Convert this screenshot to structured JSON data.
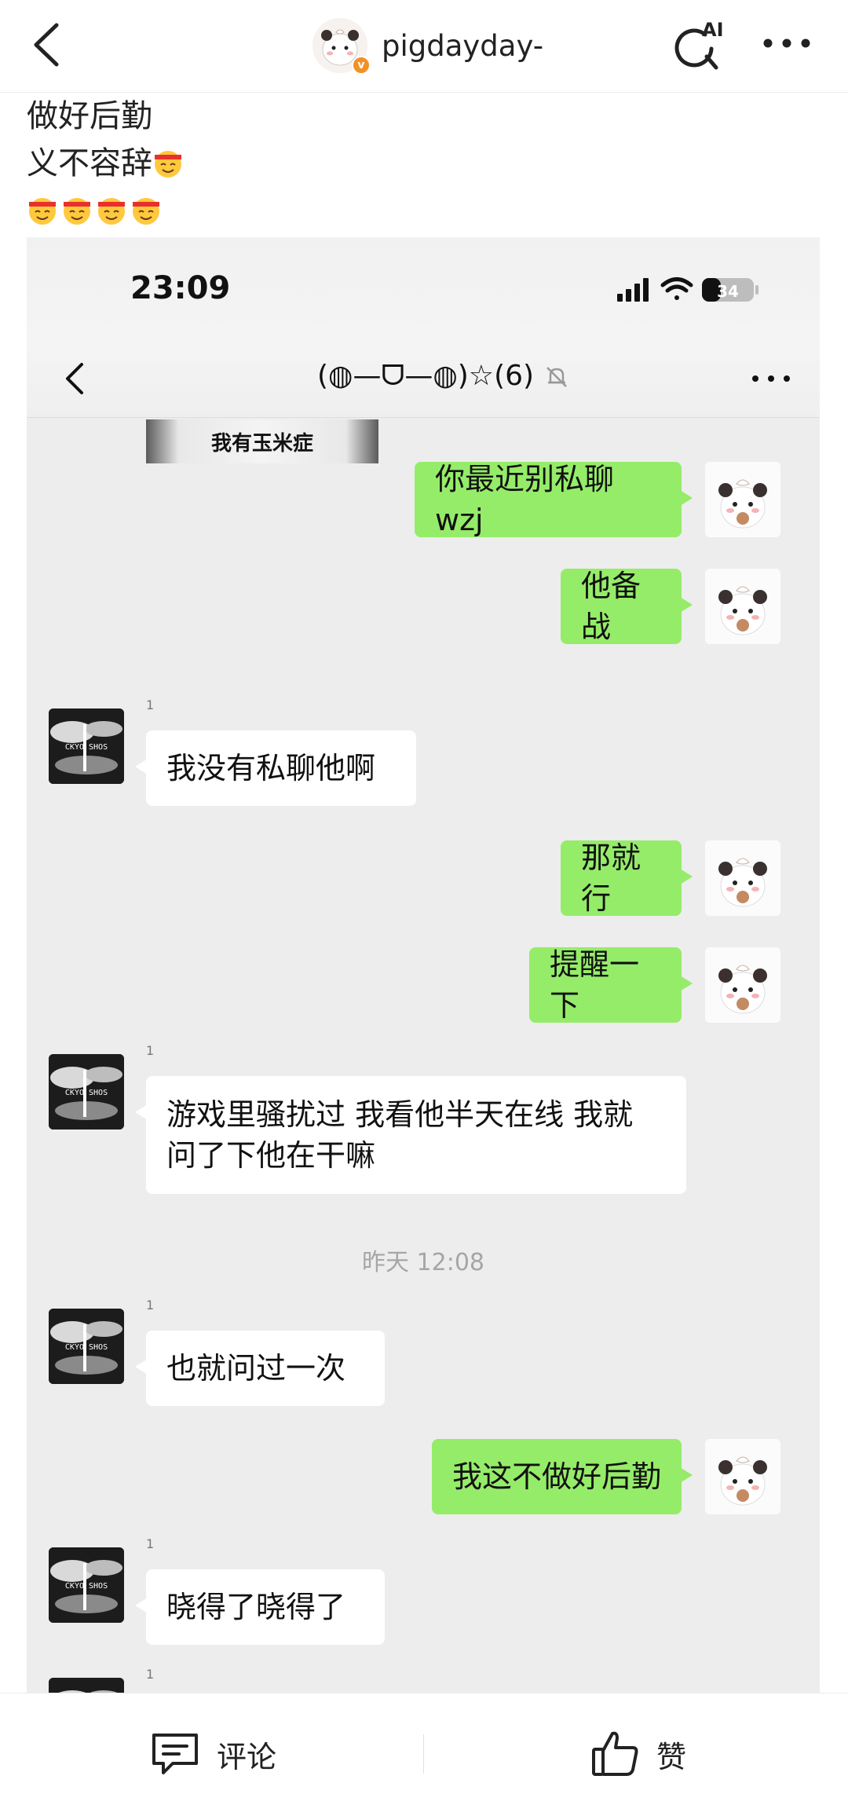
{
  "header": {
    "username": "pigdayday-",
    "ai_label": "AI"
  },
  "post": {
    "line1": "做好后勤",
    "line2": "义不容辞"
  },
  "screenshot": {
    "status_time": "23:09",
    "battery": "34",
    "chat_title": "(◍—ᗜ—◍)☆(6)",
    "sticker_caption": "我有玉米症",
    "messages": [
      {
        "from": "me",
        "text": "你最近别私聊 wzj"
      },
      {
        "from": "me",
        "text": "他备战"
      },
      {
        "from": "other",
        "sender_label": "1",
        "text": "我没有私聊他啊"
      },
      {
        "from": "me",
        "text": "那就行"
      },
      {
        "from": "me",
        "text": "提醒一下"
      },
      {
        "from": "other",
        "sender_label": "1",
        "text": "游戏里骚扰过 我看他半天在线 我就\n问了下他在干嘛"
      },
      {
        "from": "other",
        "sender_label": "1",
        "text": "也就问过一次"
      },
      {
        "from": "me",
        "text": "我这不做好后勤"
      },
      {
        "from": "other",
        "sender_label": "1",
        "text": "晓得了晓得了"
      },
      {
        "from": "other",
        "sender_label": "1",
        "text": ""
      }
    ],
    "timestamp": "昨天 12:08"
  },
  "bottom_bar": {
    "comment_label": "评论",
    "like_label": "赞"
  },
  "colors": {
    "my_bubble": "#95ec69",
    "other_bubble": "#ffffff",
    "chat_background": "#ededed",
    "verified_badge": "#f19126"
  },
  "icons": [
    "back-icon",
    "verified-icon",
    "ai-search-icon",
    "more-icon",
    "signal-icon",
    "wifi-icon",
    "battery-icon",
    "mute-icon",
    "comment-icon",
    "like-icon"
  ]
}
